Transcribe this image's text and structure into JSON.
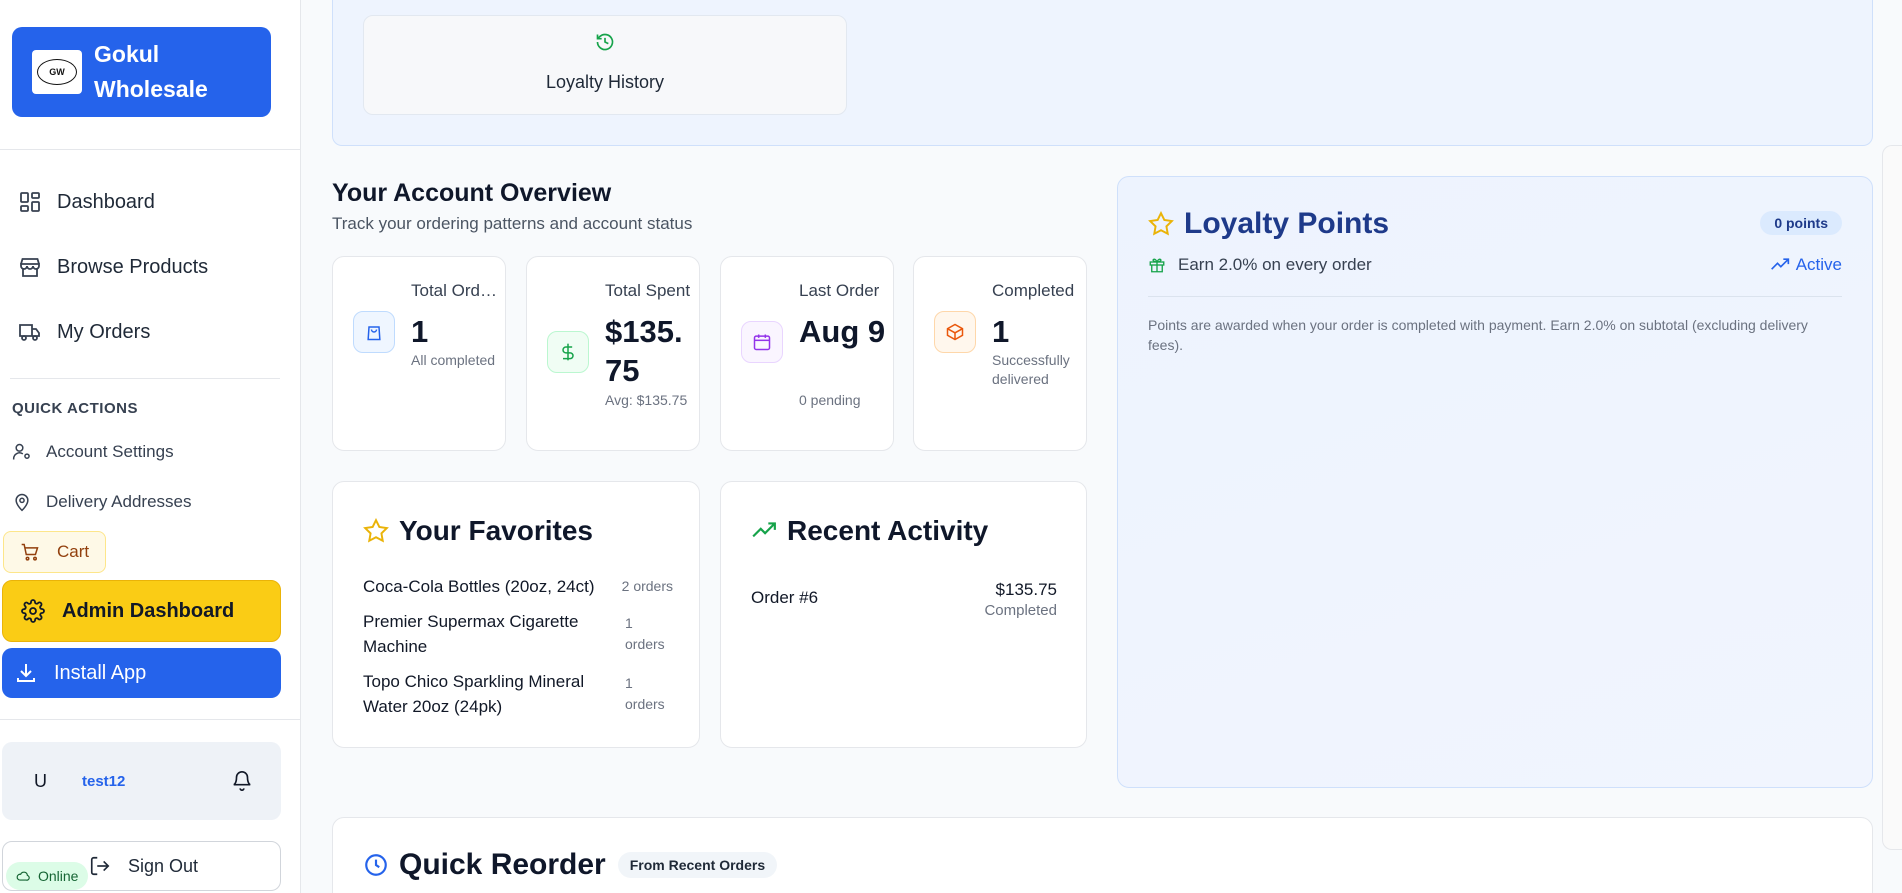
{
  "brand": {
    "name": "Gokul Wholesale",
    "logo_text": "GW"
  },
  "nav": [
    {
      "label": "Dashboard",
      "icon": "dashboard-icon"
    },
    {
      "label": "Browse Products",
      "icon": "store-icon"
    },
    {
      "label": "My Orders",
      "icon": "truck-icon"
    }
  ],
  "quick_actions": {
    "title": "QUICK ACTIONS",
    "account_settings": "Account Settings",
    "delivery_addresses": "Delivery Addresses",
    "cart": "Cart",
    "admin_dashboard": "Admin Dashboard",
    "install_app": "Install App"
  },
  "user": {
    "avatar": "U",
    "name": "test12"
  },
  "sign_out": "Sign Out",
  "status": "Online",
  "loyalty_history": "Loyalty History",
  "overview": {
    "title": "Your Account Overview",
    "subtitle": "Track your ordering patterns and account status"
  },
  "stats": [
    {
      "label": "Total Orders",
      "value": "1",
      "note": "All completed",
      "icon": "shopping-bag-icon",
      "color": "#2563eb"
    },
    {
      "label": "Total Spent",
      "value": "$135.75",
      "note": "Avg: $135.75",
      "icon": "dollar-icon",
      "color": "#16a34a"
    },
    {
      "label": "Last Order",
      "value": "Aug 9",
      "note": "0 pending",
      "icon": "calendar-icon",
      "color": "#9333ea"
    },
    {
      "label": "Completed",
      "value": "1",
      "note": "Successfully delivered",
      "icon": "package-icon",
      "color": "#ea580c"
    }
  ],
  "favorites": {
    "title": "Your Favorites",
    "items": [
      {
        "name": "Coca-Cola Bottles (20oz, 24ct)",
        "count": "2 orders"
      },
      {
        "name": "Premier Supermax Cigarette Machine",
        "count": "1 orders"
      },
      {
        "name": "Topo Chico Sparkling Mineral Water 20oz (24pk)",
        "count": "1 orders"
      }
    ]
  },
  "recent_activity": {
    "title": "Recent Activity",
    "items": [
      {
        "order": "Order #6",
        "amount": "$135.75",
        "status": "Completed"
      }
    ]
  },
  "loyalty": {
    "title": "Loyalty Points",
    "points": "0 points",
    "earn": "Earn 2.0% on every order",
    "status": "Active",
    "note": "Points are awarded when your order is completed with payment. Earn 2.0% on subtotal (excluding delivery fees)."
  },
  "quick_reorder": {
    "title": "Quick Reorder",
    "badge": "From Recent Orders"
  },
  "colors": {
    "primary": "#2563eb",
    "admin": "#facc15",
    "loyalty_bg": "#eef4fe"
  }
}
